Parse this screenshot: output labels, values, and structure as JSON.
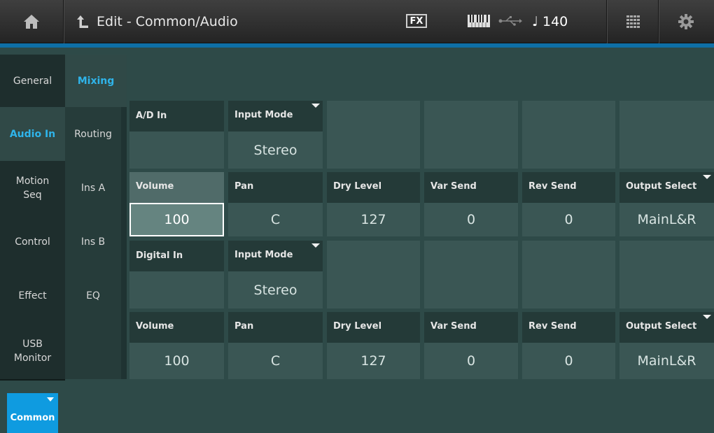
{
  "header": {
    "title": "Edit - Common/Audio",
    "fx_label": "FX",
    "tempo": "♩ 140"
  },
  "left_tabs": [
    {
      "label": "General",
      "active": false
    },
    {
      "label": "Audio In",
      "active": true
    },
    {
      "label": "Motion Seq",
      "active": false
    },
    {
      "label": "Control",
      "active": false
    },
    {
      "label": "Effect",
      "active": false
    },
    {
      "label": "USB Monitor",
      "active": false
    }
  ],
  "sub_tabs": [
    {
      "label": "Mixing",
      "active": true
    },
    {
      "label": "Routing",
      "active": false
    },
    {
      "label": "Ins A",
      "active": false
    },
    {
      "label": "Ins B",
      "active": false
    },
    {
      "label": "EQ",
      "active": false
    }
  ],
  "ad_in": {
    "section_label": "A/D In",
    "input_mode": {
      "label": "Input Mode",
      "value": "Stereo"
    },
    "params": [
      {
        "label": "Volume",
        "value": "100"
      },
      {
        "label": "Pan",
        "value": "C"
      },
      {
        "label": "Dry Level",
        "value": "127"
      },
      {
        "label": "Var Send",
        "value": "0"
      },
      {
        "label": "Rev Send",
        "value": "0"
      },
      {
        "label": "Output Select",
        "value": "MainL&R"
      }
    ]
  },
  "digital_in": {
    "section_label": "Digital In",
    "input_mode": {
      "label": "Input Mode",
      "value": "Stereo"
    },
    "params": [
      {
        "label": "Volume",
        "value": "100"
      },
      {
        "label": "Pan",
        "value": "C"
      },
      {
        "label": "Dry Level",
        "value": "127"
      },
      {
        "label": "Var Send",
        "value": "0"
      },
      {
        "label": "Rev Send",
        "value": "0"
      },
      {
        "label": "Output Select",
        "value": "MainL&R"
      }
    ]
  },
  "bottom": {
    "common_label": "Common"
  },
  "colors": {
    "accent": "#2fb4ea",
    "button_blue": "#0f9be0",
    "background": "#2e4a48"
  }
}
